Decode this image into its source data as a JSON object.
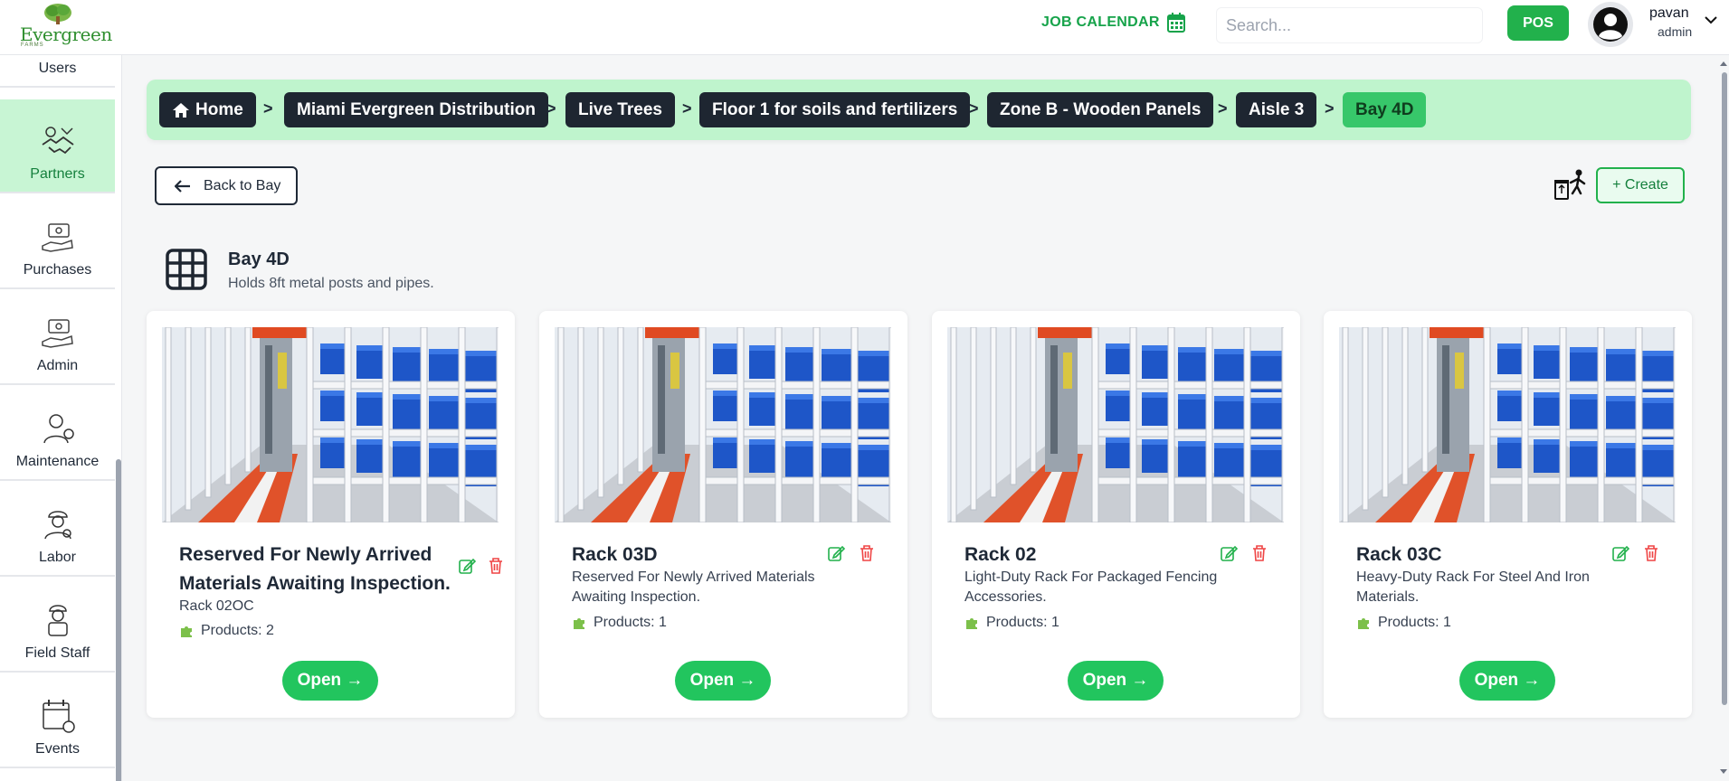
{
  "header": {
    "logo_text": "Evergreen",
    "logo_sub": "FARMS",
    "job_calendar_label": "JOB CALENDAR",
    "search_placeholder": "Search...",
    "pos_label": "POS",
    "user_name": "pavan",
    "user_role": "admin"
  },
  "sidebar": {
    "items": [
      {
        "label": "Users",
        "icon": "users-icon"
      },
      {
        "label": "Partners",
        "icon": "handshake-icon",
        "active": true
      },
      {
        "label": "Purchases",
        "icon": "purchases-icon"
      },
      {
        "label": "Admin",
        "icon": "admin-icon"
      },
      {
        "label": "Maintenance",
        "icon": "maintenance-icon"
      },
      {
        "label": "Labor",
        "icon": "labor-icon"
      },
      {
        "label": "Field Staff",
        "icon": "field-staff-icon"
      },
      {
        "label": "Events",
        "icon": "events-icon"
      }
    ]
  },
  "breadcrumb": [
    "Home",
    "Miami Evergreen Distribution",
    "Live Trees",
    "Floor 1 for soils and fertilizers",
    "Zone B - Wooden Panels",
    "Aisle 3",
    "Bay 4D"
  ],
  "breadcrumb_separator": ">",
  "actions": {
    "back_label": "Back to Bay",
    "create_label": "+ Create"
  },
  "bay": {
    "title": "Bay 4D",
    "description": "Holds 8ft metal posts and pipes."
  },
  "racks": [
    {
      "title": "Reserved For Newly Arrived Materials Awaiting Inspection.",
      "subtitle": "Rack 02OC",
      "products": "Products: 2",
      "open_label": "Open →"
    },
    {
      "title": "Rack 03D",
      "subtitle": "Reserved For Newly Arrived Materials Awaiting Inspection.",
      "products": "Products: 1",
      "open_label": "Open →"
    },
    {
      "title": "Rack 02",
      "subtitle": "Light-Duty Rack For Packaged Fencing Accessories.",
      "products": "Products: 1",
      "open_label": "Open →"
    },
    {
      "title": "Rack 03C",
      "subtitle": "Heavy-Duty Rack For Steel And Iron Materials.",
      "products": "Products: 1",
      "open_label": "Open →"
    }
  ],
  "colors": {
    "accent": "#22b14c",
    "breadcrumb_bg": "#bff4cd",
    "crumb_dark": "#1e2631",
    "delete": "#ef4444"
  }
}
